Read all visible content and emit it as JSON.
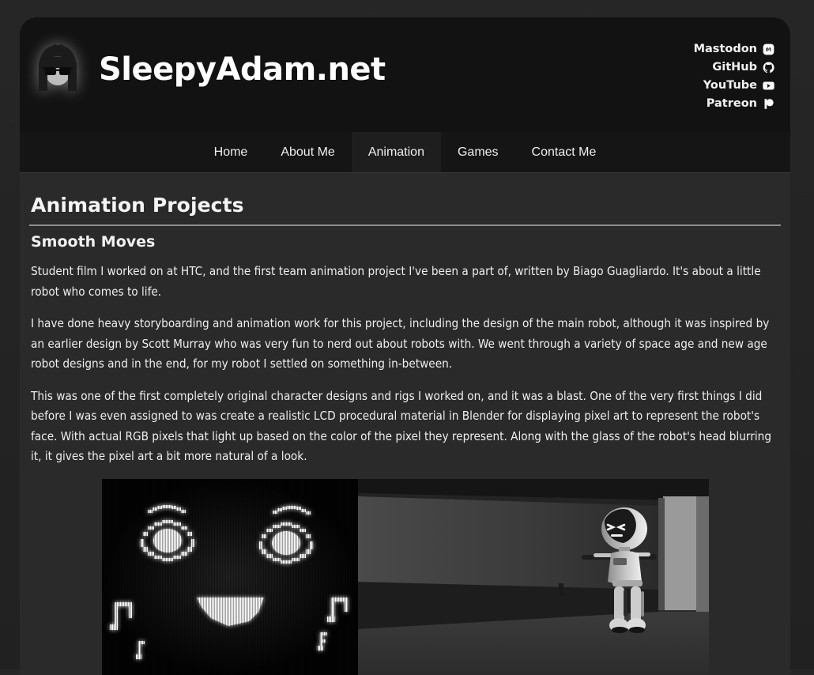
{
  "header": {
    "brand_title": "SleepyAdam.net",
    "logo_icon": "sleepy-face-avatar-icon",
    "social_links": [
      {
        "label": "Mastodon",
        "icon": "mastodon-icon"
      },
      {
        "label": "GitHub",
        "icon": "github-icon"
      },
      {
        "label": "YouTube",
        "icon": "youtube-icon"
      },
      {
        "label": "Patreon",
        "icon": "patreon-icon"
      }
    ]
  },
  "nav": {
    "items": [
      {
        "label": "Home",
        "active": false
      },
      {
        "label": "About Me",
        "active": false
      },
      {
        "label": "Animation",
        "active": true
      },
      {
        "label": "Games",
        "active": false
      },
      {
        "label": "Contact Me",
        "active": false
      }
    ]
  },
  "main": {
    "page_title": "Animation Projects",
    "project": {
      "title": "Smooth Moves",
      "paragraphs": [
        "Student film I worked on at HTC, and the first team animation project I've been a part of, written by Biago Guagliardo. It's about a little robot who comes to life.",
        "I have done heavy storyboarding and animation work for this project, including the design of the main robot, although it was inspired by an earlier design by Scott Murray who was very fun to nerd out about robots with. We went through a variety of space age and new age robot designs and in the end, for my robot I settled on something in-between.",
        "This was one of the first completely original character designs and rigs I worked on, and it was a blast. One of the very first things I did before I was even assigned to was create a realistic LCD procedural material in Blender for displaying pixel art to represent the robot's face. With actual RGB pixels that light up based on the color of the pixel they represent. Along with the glass of the robot's head blurring it, it gives the pixel art a bit more natural of a look."
      ],
      "media": [
        {
          "name": "robot-lcd-face-screenshot",
          "caption": "Pixel-art LCD robot face with music-note eyes and smile"
        },
        {
          "name": "robot-corridor-render",
          "caption": "Grayscale render of the robot standing in a corridor"
        }
      ]
    }
  },
  "theme": {
    "page_background": "#232323",
    "header_background": "#121212",
    "nav_background": "#151515",
    "nav_active_background": "#1e1e1e",
    "content_background": "#2a2a2a",
    "text_color": "#eeeeee",
    "rule_color": "#8d8d8d"
  }
}
